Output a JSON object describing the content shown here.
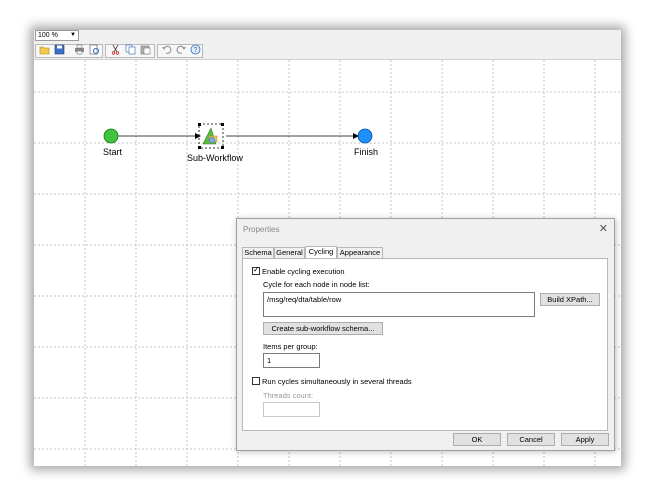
{
  "zoom": {
    "value": "100 %"
  },
  "toolbar": {
    "icons": [
      "open-folder-icon",
      "save-icon",
      "print-icon",
      "print-preview-icon",
      "cut-icon",
      "copy-icon",
      "paste-icon",
      "undo-icon",
      "redo-icon",
      "help-icon"
    ]
  },
  "workflow": {
    "start_label": "Start",
    "sub_label": "Sub-Workflow",
    "finish_label": "Finish",
    "start_color": "#3ec33e",
    "finish_color": "#1e90ff"
  },
  "dialog": {
    "title": "Properties",
    "close": "✕",
    "tabs": [
      "Schema",
      "General",
      "Cycling",
      "Appearance"
    ],
    "active_tab": "Cycling",
    "enable_cycling": {
      "label": "Enable cycling execution",
      "checked": true
    },
    "node_list_label": "Cycle for each node in node list:",
    "node_list_value": "/msg/req/dta/table/row",
    "build_xpath": "Build XPath...",
    "create_schema": "Create sub-workflow schema...",
    "items_per_group_label": "Items per group:",
    "items_per_group_value": "1",
    "run_simultaneously": {
      "label": "Run cycles simultaneously in several threads",
      "checked": false
    },
    "threads_count_label": "Threads count:",
    "threads_count_value": "",
    "ok": "OK",
    "cancel": "Cancel",
    "apply": "Apply"
  }
}
